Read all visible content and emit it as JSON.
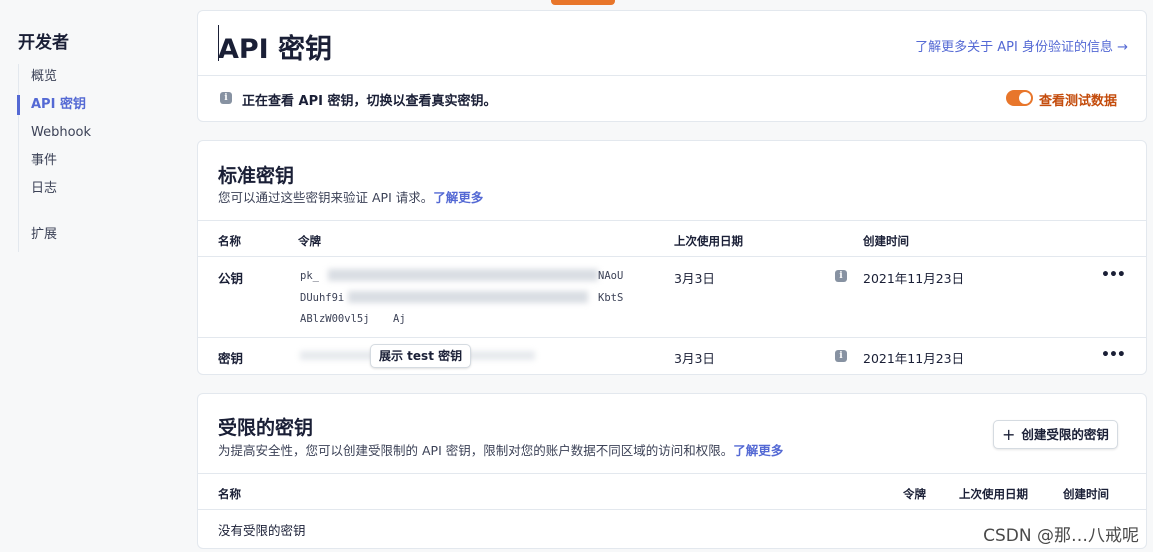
{
  "sidebar": {
    "title": "开发者",
    "items": [
      {
        "label": "概览",
        "active": false
      },
      {
        "label": "API 密钥",
        "active": true
      },
      {
        "label": "Webhook",
        "active": false
      },
      {
        "label": "事件",
        "active": false
      },
      {
        "label": "日志",
        "active": false
      },
      {
        "label": "扩展",
        "active": false
      }
    ]
  },
  "header": {
    "title": "API 密钥",
    "learn_more_auth": "了解更多关于 API 身份验证的信息 →",
    "viewing_notice": "正在查看 API 密钥，切换以查看真实密钥。",
    "test_toggle_label": "查看测试数据",
    "test_toggle_on": true
  },
  "standard_keys": {
    "title": "标准密钥",
    "description": "您可以通过这些密钥来验证 API 请求。",
    "learn_more": "了解更多",
    "columns": [
      "名称",
      "令牌",
      "上次使用日期",
      "创建时间"
    ],
    "rows": [
      {
        "name": "公钥",
        "token_lines": [
          "pk_",
          "DUuhf9i",
          "ABlzW00vl5j"
        ],
        "token_fragments": [
          "NAoU",
          "KbtS",
          "Aj"
        ],
        "last_used": "3月3日",
        "created": "2021年11月23日"
      },
      {
        "name": "密钥",
        "reveal_label": "展示 test 密钥",
        "last_used": "3月3日",
        "created": "2021年11月23日"
      }
    ]
  },
  "restricted_keys": {
    "title": "受限的密钥",
    "description": "为提高安全性，您可以创建受限制的 API 密钥，限制对您的账户数据不同区域的访问和权限。",
    "learn_more": "了解更多",
    "create_label": "创建受限的密钥",
    "columns": [
      "名称",
      "令牌",
      "上次使用日期",
      "创建时间"
    ],
    "empty_text": "没有受限的密钥"
  },
  "watermark": "CSDN @那…八戒呢",
  "icons": {
    "info": "info-icon",
    "more": "more-horizontal-icon",
    "plus": "plus-icon"
  },
  "colors": {
    "accent": "#5469d4",
    "test_toggle": "#e8762b"
  }
}
